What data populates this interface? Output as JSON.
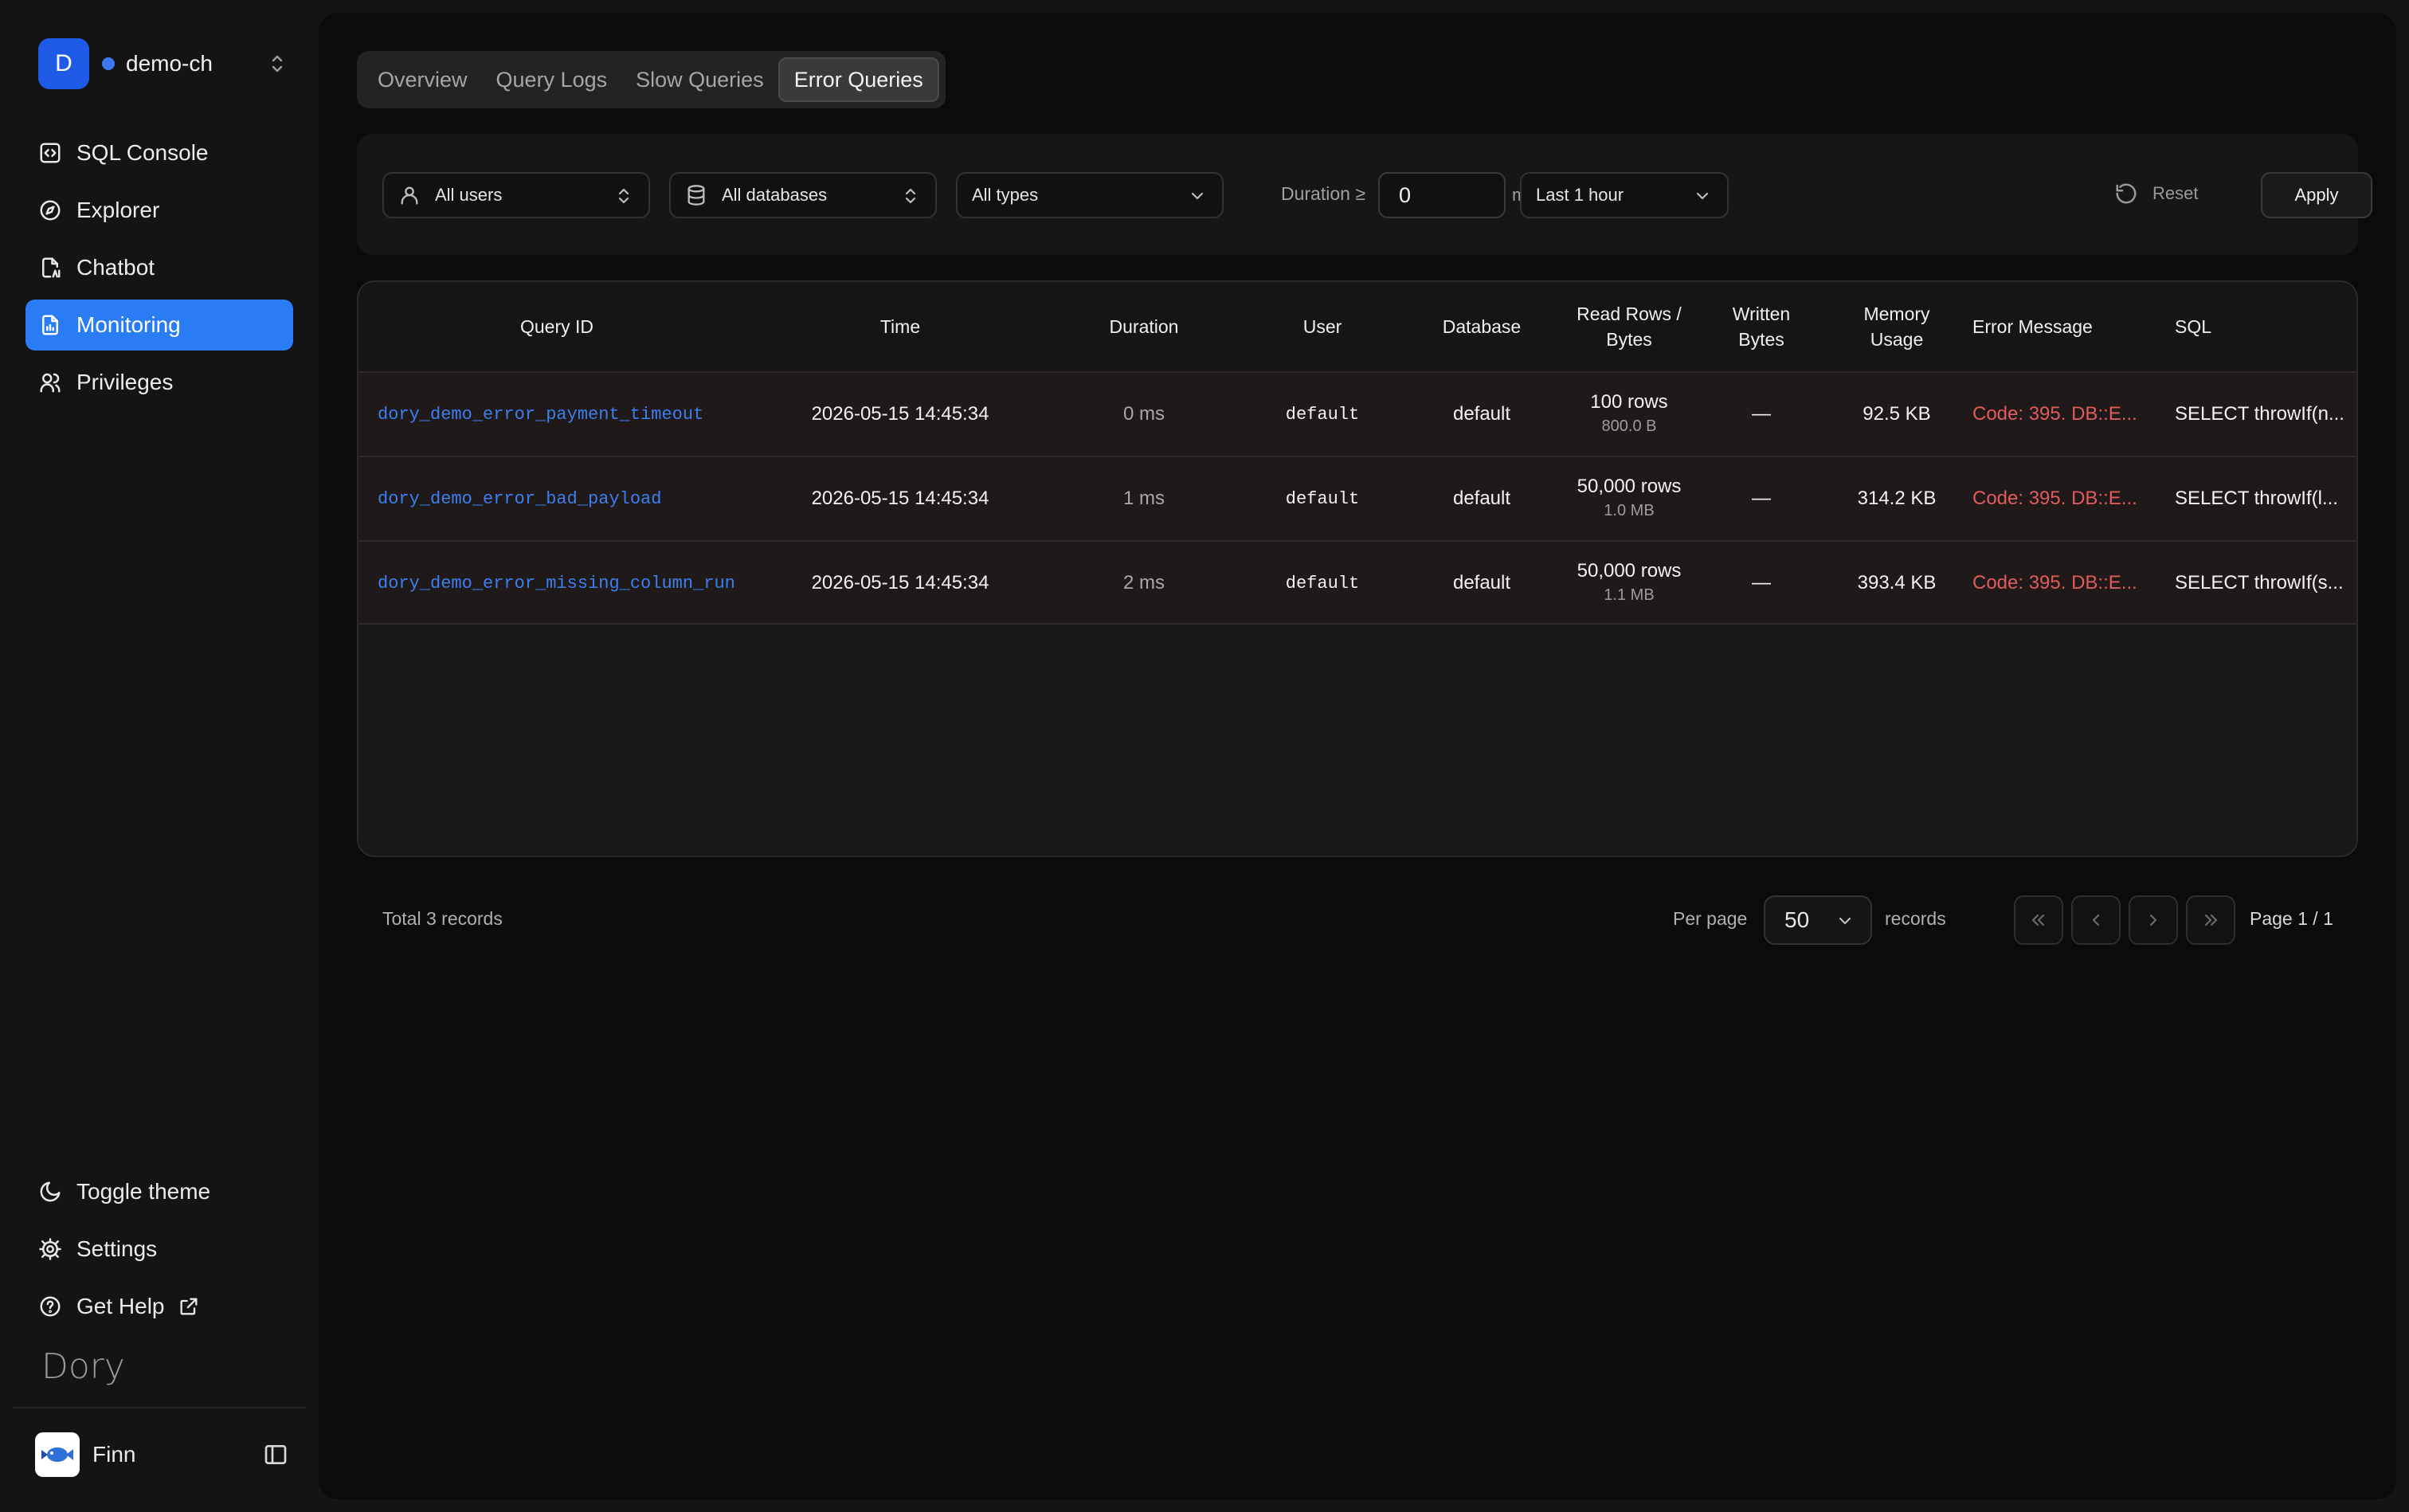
{
  "workspace": {
    "initial": "D",
    "name": "demo-ch",
    "status_color": "#3a78f2"
  },
  "nav": [
    {
      "label": "SQL Console",
      "icon": "code-square-icon",
      "active": false
    },
    {
      "label": "Explorer",
      "icon": "compass-icon",
      "active": false
    },
    {
      "label": "Chatbot",
      "icon": "file-ai-icon",
      "active": false
    },
    {
      "label": "Monitoring",
      "icon": "chart-file-icon",
      "active": true
    },
    {
      "label": "Privileges",
      "icon": "users-icon",
      "active": false
    }
  ],
  "bottom_nav": {
    "toggle_theme": "Toggle theme",
    "settings": "Settings",
    "get_help": "Get Help"
  },
  "logo": "Dory",
  "user": {
    "name": "Finn"
  },
  "tabs": [
    {
      "label": "Overview",
      "active": false
    },
    {
      "label": "Query Logs",
      "active": false
    },
    {
      "label": "Slow Queries",
      "active": false
    },
    {
      "label": "Error Queries",
      "active": true
    }
  ],
  "filters": {
    "users": "All users",
    "databases": "All databases",
    "types": "All types",
    "duration_label": "Duration ≥",
    "duration_value": "0",
    "duration_unit": "ms",
    "time_range": "Last 1 hour",
    "reset": "Reset",
    "apply": "Apply"
  },
  "table": {
    "headers": {
      "query_id": "Query ID",
      "time": "Time",
      "duration": "Duration",
      "user": "User",
      "database": "Database",
      "read_1": "Read Rows /",
      "read_2": "Bytes",
      "written_1": "Written",
      "written_2": "Bytes",
      "memory_1": "Memory",
      "memory_2": "Usage",
      "error": "Error Message",
      "sql": "SQL"
    },
    "rows": [
      {
        "id": "dory_demo_error_payment_timeout",
        "time": "2026-05-15 14:45:34",
        "duration": "0 ms",
        "user": "default",
        "database": "default",
        "read_rows": "100 rows",
        "read_bytes": "800.0 B",
        "written": "—",
        "memory": "92.5 KB",
        "error": "Code: 395. DB::E...",
        "sql": "SELECT throwIf(n..."
      },
      {
        "id": "dory_demo_error_bad_payload",
        "time": "2026-05-15 14:45:34",
        "duration": "1 ms",
        "user": "default",
        "database": "default",
        "read_rows": "50,000 rows",
        "read_bytes": "1.0 MB",
        "written": "—",
        "memory": "314.2 KB",
        "error": "Code: 395. DB::E...",
        "sql": "SELECT throwIf(l..."
      },
      {
        "id": "dory_demo_error_missing_column_run",
        "time": "2026-05-15 14:45:34",
        "duration": "2 ms",
        "user": "default",
        "database": "default",
        "read_rows": "50,000 rows",
        "read_bytes": "1.1 MB",
        "written": "—",
        "memory": "393.4 KB",
        "error": "Code: 395. DB::E...",
        "sql": "SELECT throwIf(s..."
      }
    ]
  },
  "footer": {
    "total": "Total 3 records",
    "per_page_label": "Per page",
    "per_page_value": "50",
    "records_label": "records",
    "page_info": "Page 1 / 1"
  },
  "colors": {
    "accent": "#2a7cf5",
    "error_text": "#e05c5c",
    "link": "#3c7ff0"
  }
}
